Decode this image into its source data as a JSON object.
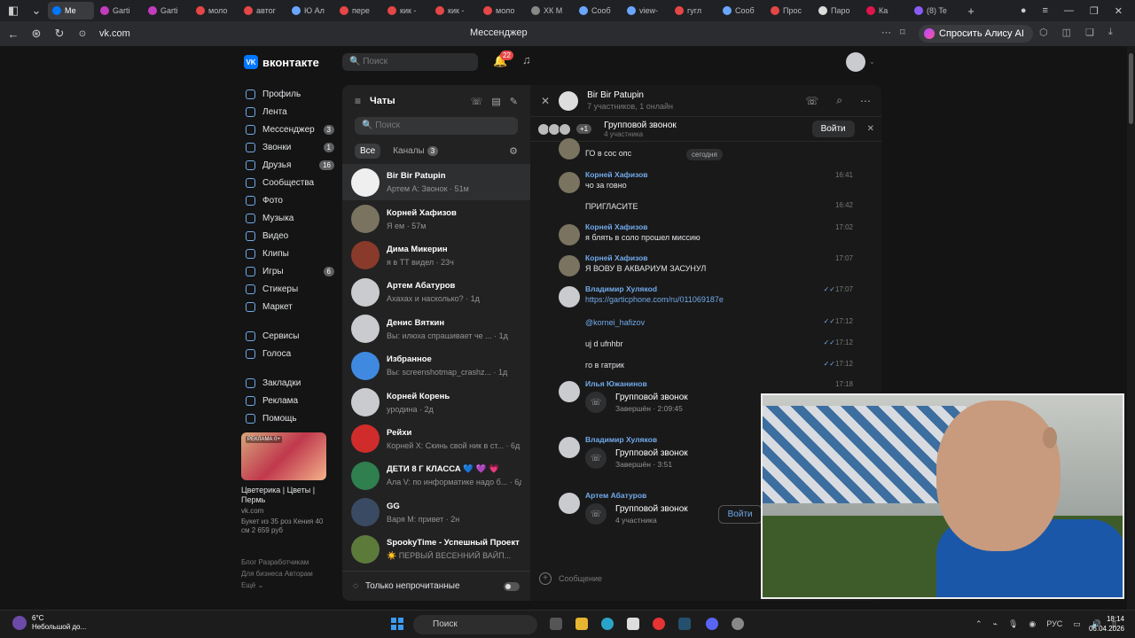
{
  "browser": {
    "tabs": [
      {
        "label": "Ме",
        "color": "#0077ff",
        "active": true
      },
      {
        "label": "Garti",
        "color": "#c33cbe"
      },
      {
        "label": "Garti",
        "color": "#c33cbe"
      },
      {
        "label": "моло",
        "color": "#e64646"
      },
      {
        "label": "автог",
        "color": "#e64646"
      },
      {
        "label": "Ю Ал",
        "color": "#6aa6ff"
      },
      {
        "label": "пере",
        "color": "#e64646"
      },
      {
        "label": "кик -",
        "color": "#e64646"
      },
      {
        "label": "кик -",
        "color": "#e64646"
      },
      {
        "label": "моло",
        "color": "#e64646"
      },
      {
        "label": "ХК М",
        "color": "#888888"
      },
      {
        "label": "Сооб",
        "color": "#6aa6ff"
      },
      {
        "label": "view-",
        "color": "#6aa6ff"
      },
      {
        "label": "гугл",
        "color": "#e64646"
      },
      {
        "label": "Сооб",
        "color": "#6aa6ff"
      },
      {
        "label": "Прос",
        "color": "#e64646"
      },
      {
        "label": "Паро",
        "color": "#dddddd"
      },
      {
        "label": "Ка",
        "color": "#e0144c"
      },
      {
        "label": "(8) Te",
        "color": "#8a5cf6"
      }
    ],
    "url": "vk.com",
    "page_title": "Мессенджер",
    "alice_label": "Спросить Алису AI"
  },
  "vk": {
    "logo": "вконтакте",
    "search_placeholder": "Поиск",
    "notif_count": "22",
    "nav": [
      {
        "label": "Профиль"
      },
      {
        "label": "Лента"
      },
      {
        "label": "Мессенджер",
        "count": "3"
      },
      {
        "label": "Звонки",
        "count": "1"
      },
      {
        "label": "Друзья",
        "count": "16"
      },
      {
        "label": "Сообщества"
      },
      {
        "label": "Фото"
      },
      {
        "label": "Музыка"
      },
      {
        "label": "Видео"
      },
      {
        "label": "Клипы"
      },
      {
        "label": "Игры",
        "count": "6"
      },
      {
        "label": "Стикеры"
      },
      {
        "label": "Маркет"
      }
    ],
    "nav2": [
      {
        "label": "Сервисы"
      },
      {
        "label": "Голоса"
      }
    ],
    "nav3": [
      {
        "label": "Закладки"
      },
      {
        "label": "Реклама"
      },
      {
        "label": "Помощь"
      }
    ],
    "ad": {
      "badge": "РЕКЛАМА 0+",
      "title": "Цветерика | Цветы | Пермь",
      "domain": "vk.com",
      "desc": "Букет из 35 роз Кения 40 см 2 659 руб"
    },
    "footer": [
      "Блог Разработчикам",
      "Для бизнеса Авторам",
      "Ещё ⌄"
    ]
  },
  "chatlist": {
    "title": "Чаты",
    "search_placeholder": "Поиск",
    "tab_all": "Все",
    "tab_channels": "Каналы",
    "channels_count": "3",
    "only_unread": "Только непрочитанные",
    "conversations": [
      {
        "name": "Bir Bir Patupin",
        "last": "Артем А: Звонок · 51м",
        "av": "#efefef"
      },
      {
        "name": "Корней Хафизов",
        "last": "Я ем · 57м",
        "av": "#7a7360"
      },
      {
        "name": "Дима Микерин",
        "last": "я в ТТ видел · 23ч",
        "av": "#8a3a2a"
      },
      {
        "name": "Артем Абатуров",
        "last": "Ахахах и насколько? · 1д",
        "av": "#c9cbce"
      },
      {
        "name": "Денис Вяткин",
        "last": "Вы: илюха спрашивает че ... · 1д",
        "av": "#c9cbce"
      },
      {
        "name": "Избранное",
        "last": "Вы: screenshotmap_crashz... · 1д",
        "av": "#3f8ae0"
      },
      {
        "name": "Корней Корень",
        "last": "уродина · 2д",
        "av": "#c9cbce"
      },
      {
        "name": "Рейхи",
        "last": "Корней Х: Скинь свой ник в ст... · 6д",
        "av": "#d02c2c"
      },
      {
        "name": "ДЕТИ 8 Г КЛАССА 💙 💜 💗",
        "last": "Ала V: по информатике надо б... · 6д",
        "av": "#2f7f4f"
      },
      {
        "name": "GG",
        "last": "Варя М: привет · 2н",
        "av": "#3b4a63"
      },
      {
        "name": "SpookyTime - Успешный Проект",
        "last": "☀️ ПЕРВЫЙ ВЕСЕННИЙ ВАЙП...",
        "av": "#5c7a3a"
      }
    ]
  },
  "chat": {
    "name": "Bir Bir Patupin",
    "subtitle": "7 участников, 1 онлайн",
    "callbar_title": "Групповой звонок",
    "callbar_sub": "4 участника",
    "callbar_more": "+1",
    "join_label": "Войти",
    "date_pill": "сегодня",
    "composer_placeholder": "Сообщение",
    "messages": {
      "m0_text": "ГО в сос опс",
      "m1_author": "Корней Хафизов",
      "m1_text": "чо за говно",
      "m1_time": "16:41",
      "m2_text": "ПРИГЛАСИТЕ",
      "m2_time": "16:42",
      "m3_author": "Корней Хафизов",
      "m3_text": "я блять в соло прошел миссию",
      "m3_time": "17:02",
      "m4_author": "Корней Хафизов",
      "m4_text": "Я ВОВУ В АКВАРИУМ ЗАСУНУЛ",
      "m4_time": "17:07",
      "m5_author": "Владимир Хулякоd",
      "m5_text": "https://garticphone.com/ru/011069187e",
      "m5_time": "17:07",
      "m6_text": "@kornei_hafizov",
      "m6_time": "17:12",
      "m7_text": "uj d ufnhbr",
      "m7_time": "17:12",
      "m8_text": "го в гатрик",
      "m8_time": "17:12",
      "m9_author": "Илья Южанинов",
      "m9_time": "17:18",
      "m9_call": "Групповой звонок",
      "m9_status": "Завершён · 2:09:45",
      "m10_author": "Владимир Хуляков",
      "m10_call": "Групповой звонок",
      "m10_status": "Завершён · 3:51",
      "m11_author": "Артем Абатуров",
      "m11_call": "Групповой звонок",
      "m11_status": "4 участника",
      "m11_join": "Войти"
    }
  },
  "taskbar": {
    "temp": "6°C",
    "weather": "Небольшой до...",
    "search": "Поиск",
    "lang": "РУС",
    "time": "18:14",
    "date": "06.04.2026"
  }
}
